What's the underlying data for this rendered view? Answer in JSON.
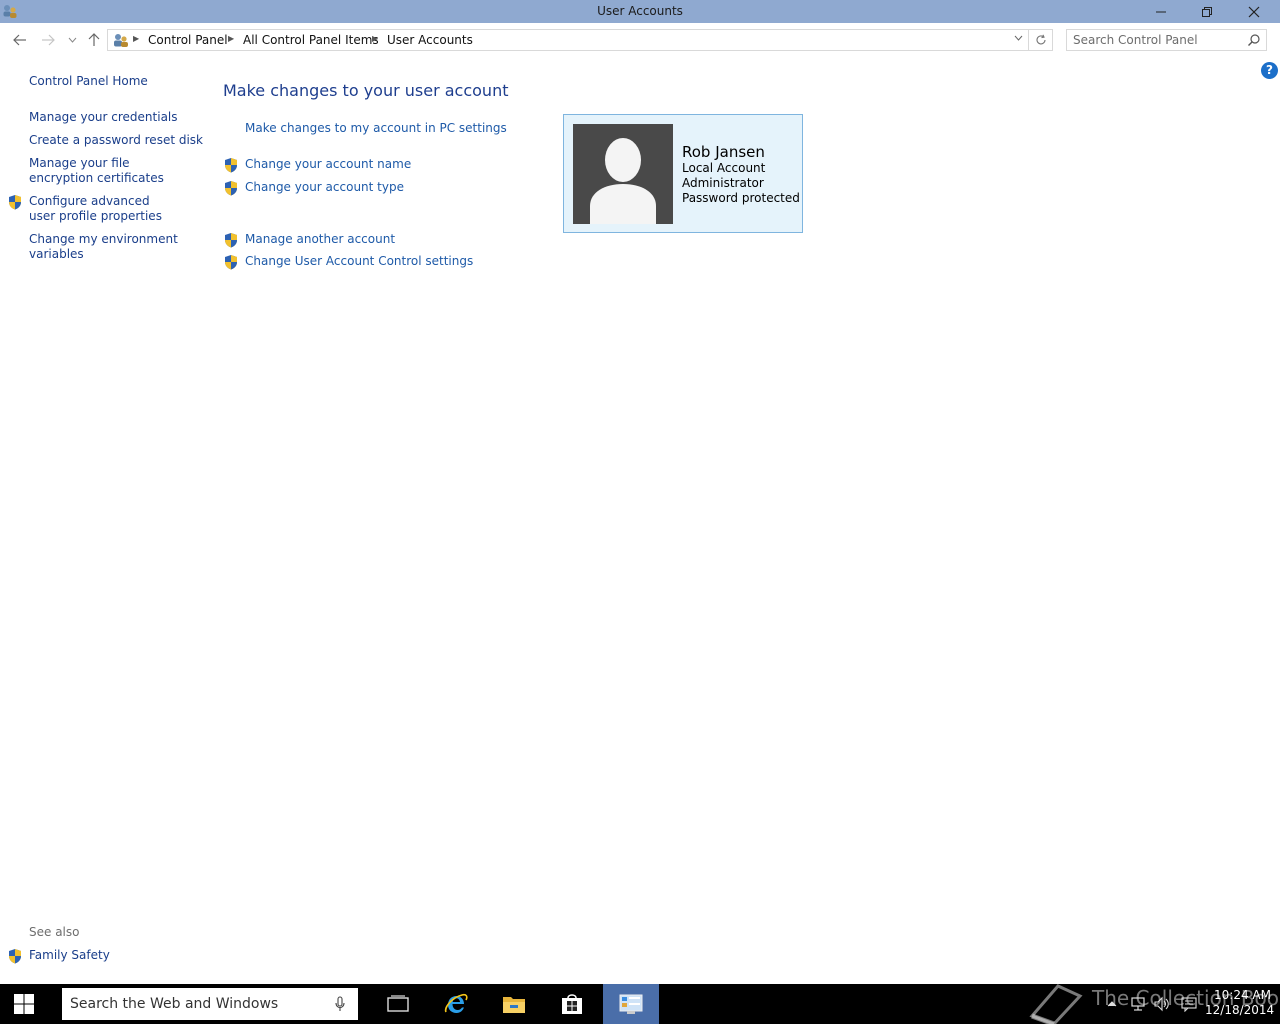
{
  "window": {
    "title": "User Accounts"
  },
  "address_bar": {
    "breadcrumbs": [
      "Control Panel",
      "All Control Panel Items",
      "User Accounts"
    ],
    "search_placeholder": "Search Control Panel"
  },
  "help_glyph": "?",
  "left_pane": {
    "home": "Control Panel Home",
    "tasks": [
      {
        "label": "Manage your credentials",
        "shield": false
      },
      {
        "label": "Create a password reset disk",
        "shield": false
      },
      {
        "label": "Manage your file encryption certificates",
        "shield": false
      },
      {
        "label": "Configure advanced user profile properties",
        "shield": true
      },
      {
        "label": "Change my environment variables",
        "shield": false
      }
    ],
    "see_also_heading": "See also",
    "see_also": [
      {
        "label": "Family Safety",
        "shield": true
      }
    ]
  },
  "main": {
    "heading": "Make changes to your user account",
    "links": [
      {
        "label": "Make changes to my account in PC settings",
        "shield": false
      },
      {
        "label": "Change your account name",
        "shield": true
      },
      {
        "label": "Change your account type",
        "shield": true
      },
      {
        "label": "Manage another account",
        "shield": true
      },
      {
        "label": "Change User Account Control settings",
        "shield": true
      }
    ]
  },
  "account": {
    "name": "Rob Jansen",
    "details": [
      "Local Account",
      "Administrator",
      "Password protected"
    ]
  },
  "taskbar": {
    "search_placeholder": "Search the Web and Windows",
    "apps": [
      "task-view-icon",
      "internet-explorer-icon",
      "file-explorer-icon",
      "store-icon",
      "control-panel-icon"
    ],
    "active_app": "control-panel-icon",
    "clock_time": "10:24 AM",
    "clock_date": "12/18/2014",
    "watermark": "The Collection Book"
  },
  "colors": {
    "titlebar": "#8fa9d0",
    "link": "#1e5aa8",
    "tile_bg": "#e5f3fb",
    "tile_border": "#7fb5df",
    "taskbar": "#000000",
    "taskbar_active": "#4a6ea9"
  }
}
